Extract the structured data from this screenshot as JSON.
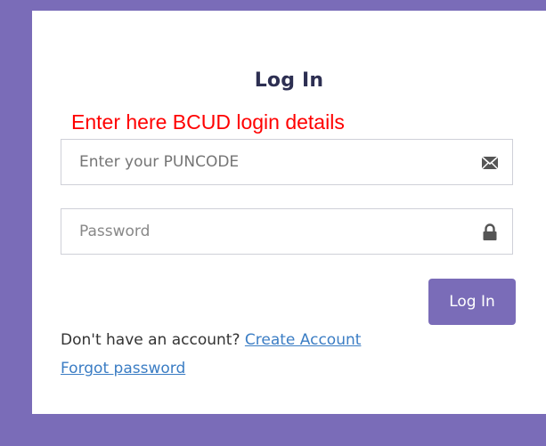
{
  "login": {
    "title": "Log In",
    "annotation": "Enter here BCUD login details",
    "username_placeholder": "Enter your PUNCODE",
    "password_placeholder": "Password",
    "submit_label": "Log In",
    "no_account_text": "Don't have an account?",
    "create_account_label": "Create Account",
    "forgot_password_label": "Forgot password"
  },
  "icons": {
    "username": "envelope-icon",
    "password": "lock-icon"
  },
  "colors": {
    "background": "#7a6cb8",
    "button": "#7a6cb8",
    "title": "#2d2f52",
    "annotation": "#ff0000",
    "link": "#3b7dc4"
  }
}
